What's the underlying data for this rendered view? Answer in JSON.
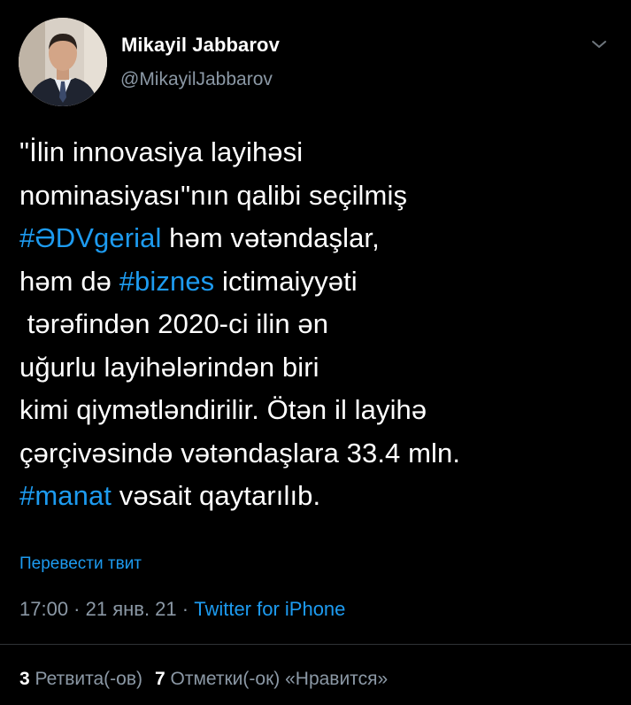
{
  "user": {
    "name": "Mikayil Jabbarov",
    "handle": "@MikayilJabbarov"
  },
  "tweet": {
    "line1": "\"İlin innovasiya layihəsi",
    "line2": "nominasiyası\"nın qalibi seçilmiş",
    "hashtag1": "#ƏDVgerial",
    "line3_rest": " həm vətəndaşlar,",
    "line4_start": "həm də ",
    "hashtag2": "#biznes",
    "line4_rest": " ictimaiyyəti",
    "line5": " tərəfindən 2020-ci ilin ən",
    "line6": "uğurlu layihələrindən biri",
    "line7": "kimi qiymətləndirilir. Ötən il layihə",
    "line8": "çərçivəsində vətəndaşlara 33.4 mln.",
    "hashtag3": "#manat",
    "line9_rest": " vəsait qaytarılıb."
  },
  "translate_label": "Перевести твит",
  "meta": {
    "time": "17:00",
    "sep1": " · ",
    "date": "21 янв. 21",
    "sep2": " · ",
    "source": "Twitter for iPhone"
  },
  "stats": {
    "retweets_count": "3",
    "retweets_label": " Ретвита(-ов)",
    "likes_count": "7",
    "likes_label": " Отметки(-ок) «Нравится»"
  },
  "icons": {
    "menu": "chevron-down-icon"
  },
  "colors": {
    "background": "#000000",
    "link": "#1d9bf0",
    "secondary": "#8b98a5",
    "text": "#ffffff"
  }
}
